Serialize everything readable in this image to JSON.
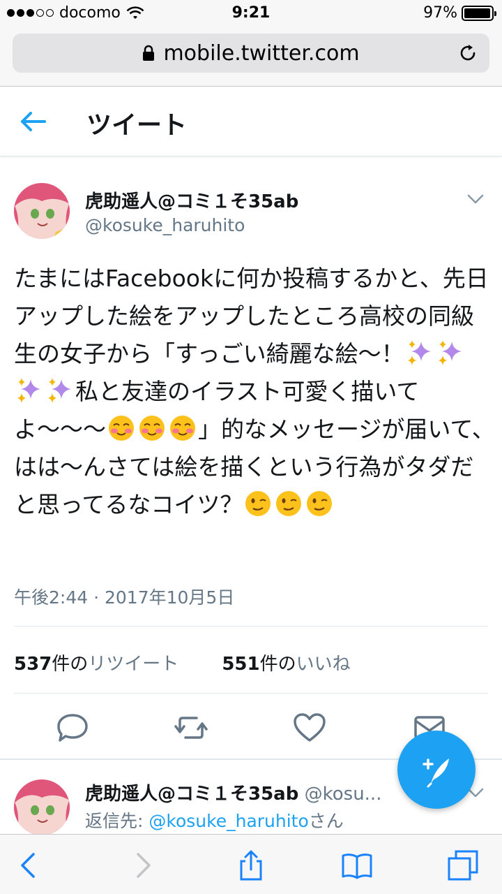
{
  "status_bar": {
    "carrier": "docomo",
    "time": "9:21",
    "battery": "97%",
    "battery_level": 0.97,
    "signal_bars": 3,
    "signal_total": 5
  },
  "browser": {
    "url": "mobile.twitter.com"
  },
  "header": {
    "title": "ツイート"
  },
  "tweet": {
    "display_name": "虎助遥人@コミ１そ35ab",
    "handle": "@kosuke_haruhito",
    "text_part1": "たまにはFacebookに何か投稿するかと、先日アップした絵をアップしたところ高校の同級生の女子から「すっごい綺麗な絵〜！",
    "text_part2": "私と友達のイラスト可愛く描いてよ〜〜〜",
    "text_part3": "」的なメッセージが届いて、はは〜んさては絵を描くという行為がタダだと思ってるなコイツ？",
    "timestamp": "午後2:44 · 2017年10月5日",
    "retweets_count": "537",
    "retweets_unit": "件の",
    "retweets_label": "リツイート",
    "likes_count": "551",
    "likes_unit": "件の",
    "likes_label": "いいね",
    "emojis": [
      "sparkles",
      "smiling-blush",
      "winking-face"
    ],
    "accent_color": "#1da1f2"
  },
  "reply": {
    "display_name": "虎助遥人@コミ１そ35ab",
    "handle": "@kosu...",
    "reply_prefix": "返信先: ",
    "reply_mention": "@kosuke_haruhito",
    "reply_suffix": "さん"
  }
}
